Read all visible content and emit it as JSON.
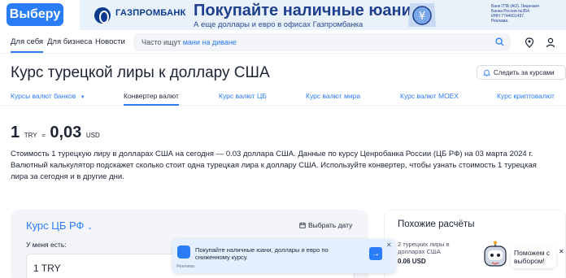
{
  "header": {
    "logo_label": "Выберу",
    "ad": {
      "brand": "ГАЗПРОМБАНК",
      "title": "Покупайте наличные юани",
      "subtitle": "А еще доллары и евро в офисах Газпромбанка",
      "legal": "Банк ГПБ (АО). Лицензия Банка России №354. ИНН 7744001497. Реклама."
    }
  },
  "nav": {
    "items": [
      {
        "label": "Для себя",
        "active": true
      },
      {
        "label": "Для бизнеса",
        "active": false
      },
      {
        "label": "Новости",
        "active": false
      }
    ],
    "search": {
      "prefix": "Часто ищут ",
      "suggestion": "мани на диване"
    }
  },
  "page": {
    "title": "Курс турецкой лиры к доллару США",
    "follow_label": "Следить за курсами"
  },
  "tabs": [
    {
      "label": "Курсы валют банков",
      "active": false,
      "dropdown": true
    },
    {
      "label": "Конвертер валют",
      "active": true,
      "dropdown": false
    },
    {
      "label": "Курс валют ЦБ",
      "active": false,
      "dropdown": false
    },
    {
      "label": "Курс валют мира",
      "active": false,
      "dropdown": false
    },
    {
      "label": "Курс валют MOEX",
      "active": false,
      "dropdown": false
    },
    {
      "label": "Курс криптовалют",
      "active": false,
      "dropdown": false
    }
  ],
  "rate": {
    "base_amount": "1",
    "base_code": "TRY",
    "equals": "=",
    "value": "0,03",
    "quote_code": "USD"
  },
  "description": "Стоимость 1 турецкую лиру в долларах США на сегодня — 0.03 доллара США. Данные по курсу Ценробанка России (ЦБ РФ) на 03 марта 2024 г. Валютный калькулятор подскажет сколько стоит одна турецкая лира к доллару США. Используйте конвертер, чтобы узнать стоимость 1 турецкая лира за сегодня и в другие дни.",
  "converter": {
    "source_label": "Курс ЦБ РФ",
    "pick_date_label": "Выбрать дату",
    "have_label": "У меня есть:",
    "amount_value": "1 TRY"
  },
  "similar": {
    "title": "Похожие расчёты",
    "item_label": "2 турецких лиры в долларах США",
    "item_value": "0.06 USD"
  },
  "popup": {
    "text": "Покупайте наличные юани, доллары и евро по сниженному курсу.",
    "label": "Реклама"
  },
  "help": {
    "text": "Поможем с выбором!"
  },
  "colors": {
    "accent": "#2a7df6",
    "text": "#1d2434",
    "card_bg": "#f3f5f8"
  }
}
